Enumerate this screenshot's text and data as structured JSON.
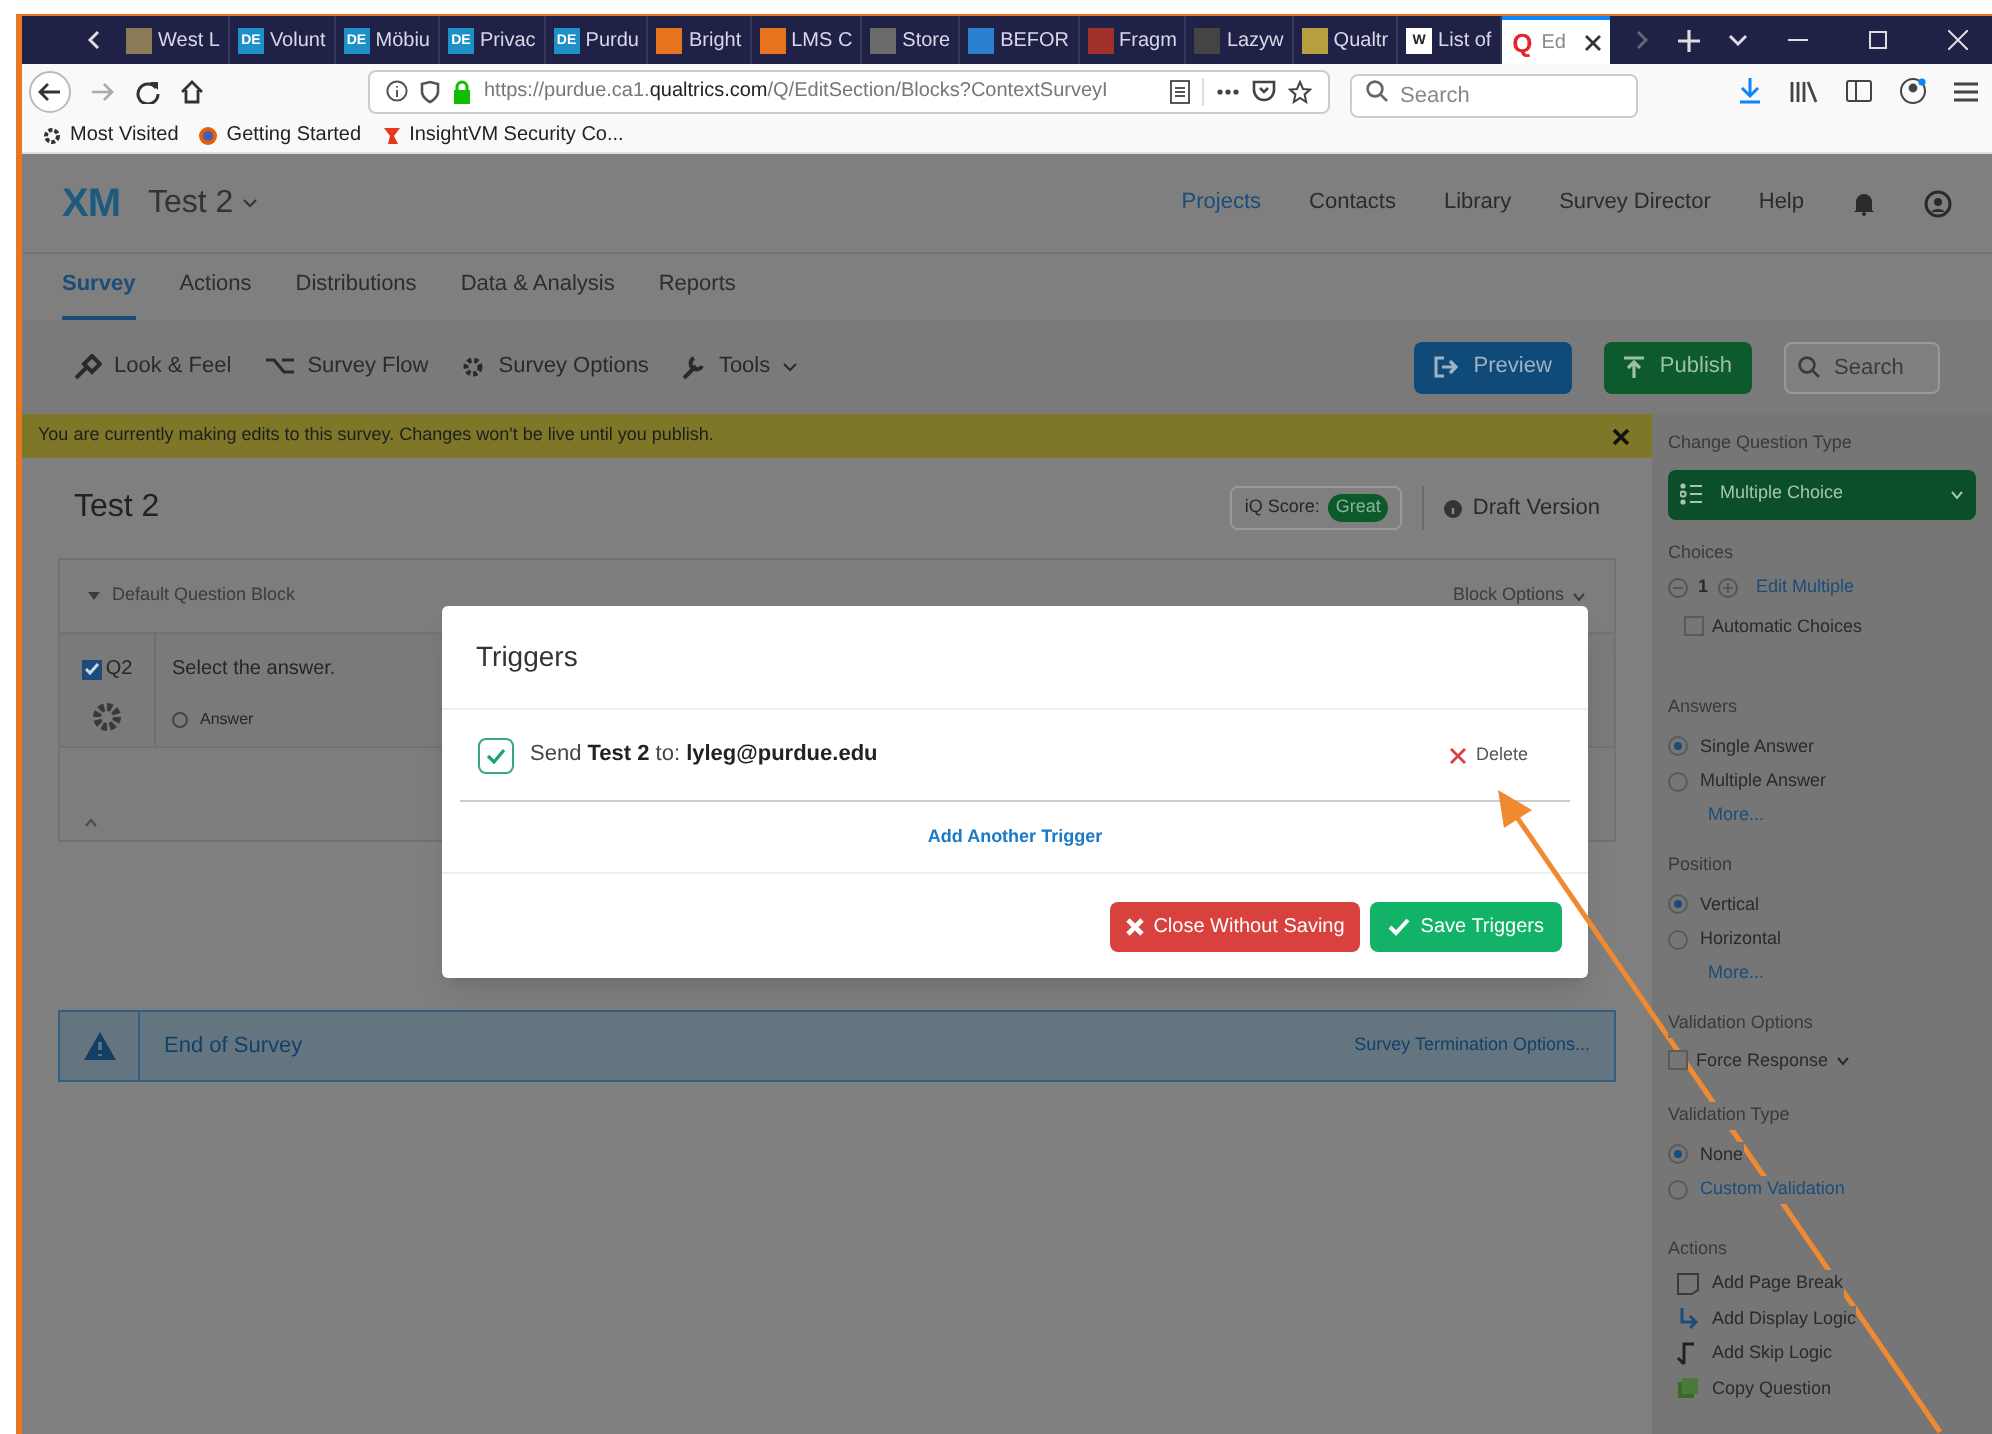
{
  "browser": {
    "tabs": [
      {
        "label": "West L",
        "selected": false,
        "color": "#8a7a55"
      },
      {
        "label": "Volunt",
        "selected": false,
        "color": "#1e90c8",
        "icon_text": "DE"
      },
      {
        "label": "Möbiu",
        "selected": false,
        "color": "#1e90c8",
        "icon_text": "DE"
      },
      {
        "label": "Privac",
        "selected": false,
        "color": "#1e90c8",
        "icon_text": "DE"
      },
      {
        "label": "Purdu",
        "selected": false,
        "color": "#1e90c8",
        "icon_text": "DE"
      },
      {
        "label": "Bright",
        "selected": false,
        "color": "#e8731e"
      },
      {
        "label": "LMS C",
        "selected": false,
        "color": "#e8731e"
      },
      {
        "label": "Store",
        "selected": false,
        "color": "#6a6a6a"
      },
      {
        "label": "BEFOR",
        "selected": false,
        "color": "#2a7fd0"
      },
      {
        "label": "Fragm",
        "selected": false,
        "color": "#a0302a"
      },
      {
        "label": "Lazyw",
        "selected": false,
        "color": "#444444"
      },
      {
        "label": "Qualtr",
        "selected": false,
        "color": "#b8a040"
      },
      {
        "label": "List of",
        "selected": false,
        "color": "#ffffff",
        "icon_text": "W"
      },
      {
        "label": "Ed",
        "selected": true,
        "color": "#e0282e",
        "icon_text": "Q"
      }
    ],
    "url": "https://purdue.ca1.**qualtrics.com**/Q/EditSection/Blocks?ContextSurveyI",
    "search_placeholder": "Search",
    "bookmarks": [
      "Most Visited",
      "Getting Started",
      "InsightVM Security Co..."
    ]
  },
  "app": {
    "logo": "XM",
    "survey_name": "Test 2",
    "nav": [
      {
        "label": "Projects",
        "selected": true
      },
      {
        "label": "Contacts",
        "selected": false
      },
      {
        "label": "Library",
        "selected": false
      },
      {
        "label": "Survey Director",
        "selected": false
      },
      {
        "label": "Help",
        "selected": false
      }
    ],
    "tabs": [
      {
        "label": "Survey",
        "selected": true
      },
      {
        "label": "Actions",
        "selected": false
      },
      {
        "label": "Distributions",
        "selected": false
      },
      {
        "label": "Data & Analysis",
        "selected": false
      },
      {
        "label": "Reports",
        "selected": false
      }
    ],
    "tools": [
      "Look & Feel",
      "Survey Flow",
      "Survey Options",
      "Tools"
    ],
    "preview": "Preview",
    "publish": "Publish",
    "search_placeholder": "Search"
  },
  "banner": "You are currently making edits to this survey. Changes won't be live until you publish.",
  "survey": {
    "title": "Test 2",
    "iq_label": "iQ Score:",
    "iq_badge": "Great",
    "version": "Draft Version",
    "block": {
      "name": "Default Question Block",
      "options": "Block Options",
      "question": {
        "number": "Q2",
        "checked": true,
        "text": "Select the answer.",
        "choices": [
          {
            "label": "Answer",
            "selected": false
          }
        ]
      }
    },
    "end": {
      "label": "End of Survey",
      "options": "Survey Termination Options..."
    }
  },
  "sidebar": {
    "type_heading": "Change Question Type",
    "type": "Multiple Choice",
    "choices_heading": "Choices",
    "choice_count": "1",
    "edit_multiple": "Edit Multiple",
    "auto_choices": {
      "label": "Automatic Choices",
      "checked": false
    },
    "answers_heading": "Answers",
    "answers": [
      {
        "label": "Single Answer",
        "selected": true
      },
      {
        "label": "Multiple Answer",
        "selected": false
      }
    ],
    "answers_more": "More...",
    "position_heading": "Position",
    "positions": [
      {
        "label": "Vertical",
        "selected": true
      },
      {
        "label": "Horizontal",
        "selected": false
      }
    ],
    "position_more": "More...",
    "validation_heading": "Validation Options",
    "force": {
      "label": "Force Response",
      "checked": false
    },
    "vtype_heading": "Validation Type",
    "vtypes": [
      {
        "label": "None",
        "selected": true
      },
      {
        "label": "Custom Validation",
        "selected": false
      }
    ],
    "actions_heading": "Actions",
    "actions": [
      "Add Page Break",
      "Add Display Logic",
      "Add Skip Logic",
      "Copy Question"
    ]
  },
  "dialog": {
    "title": "Triggers",
    "triggers": [
      {
        "checked": true,
        "text": "Send **Test 2** to: **lyleg@purdue.edu**",
        "delete": "Delete"
      }
    ],
    "add": "Add Another Trigger",
    "cancel": "Close Without Saving",
    "save": "Save Triggers"
  }
}
